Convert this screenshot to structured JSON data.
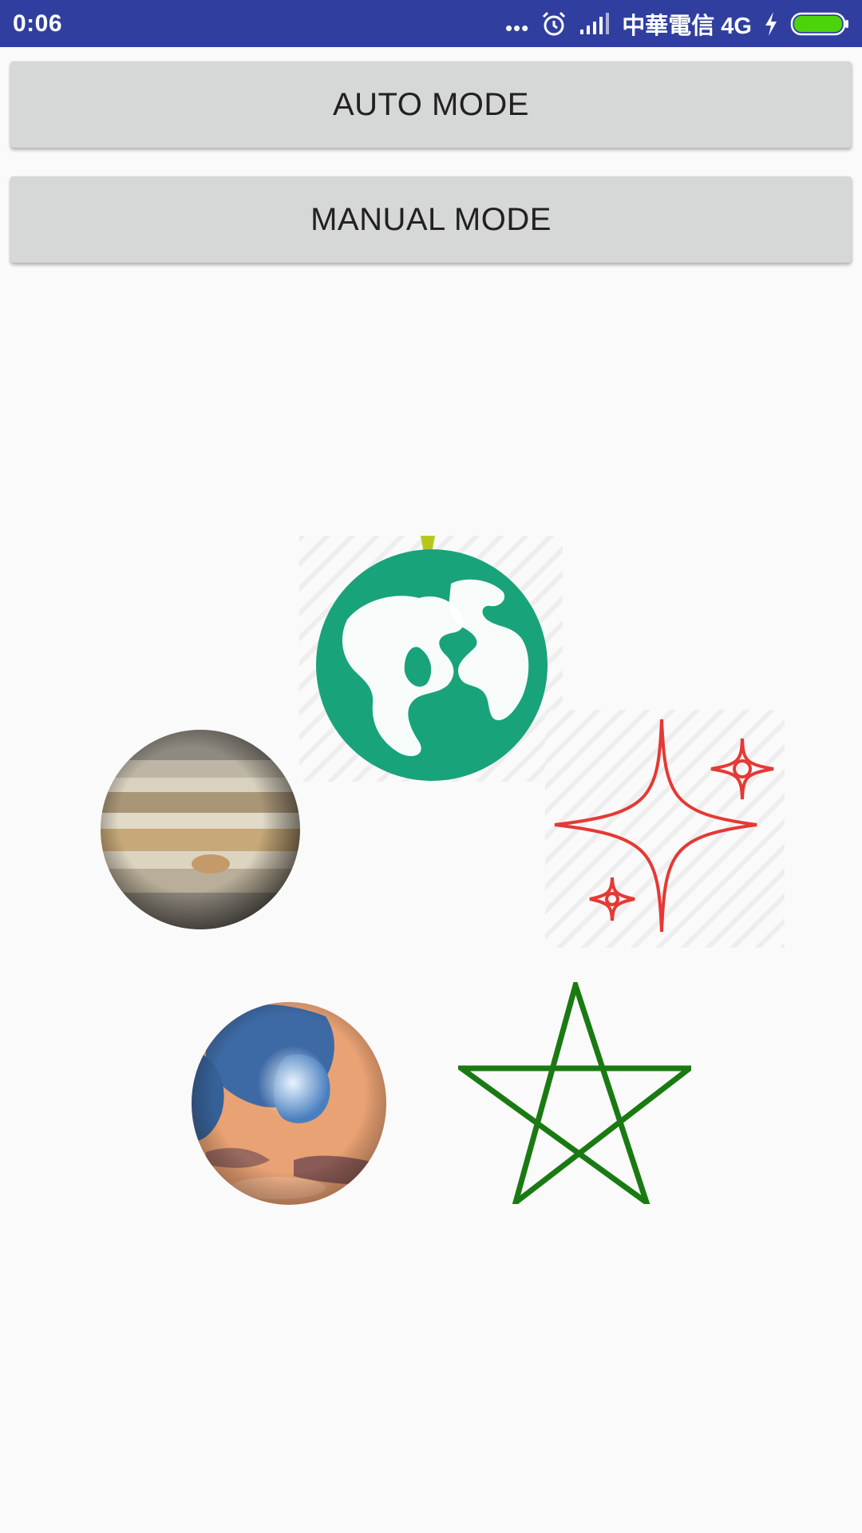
{
  "status_bar": {
    "time": "0:06",
    "dots": "•••",
    "carrier": "中華電信 4G",
    "icons": [
      "more-dots-icon",
      "alarm-clock-icon",
      "signal-bars-icon",
      "charging-bolt-icon",
      "battery-icon"
    ],
    "battery_level_percent": 100,
    "battery_color": "#4cd40a"
  },
  "buttons": {
    "auto_mode": "AUTO MODE",
    "manual_mode": "MANUAL MODE"
  },
  "sprites": [
    {
      "name": "earth-globe-icon",
      "color": "#19a37b"
    },
    {
      "name": "jupiter-planet-image"
    },
    {
      "name": "sparkle-stars-icon",
      "color": "#e53935"
    },
    {
      "name": "mars-planet-image"
    },
    {
      "name": "pentagram-star-icon",
      "color": "#1a7a12"
    }
  ],
  "colors": {
    "status_bar": "#303f9f",
    "button_background": "#d6d7d7",
    "button_text": "#212121",
    "page_background": "#fafafa"
  }
}
